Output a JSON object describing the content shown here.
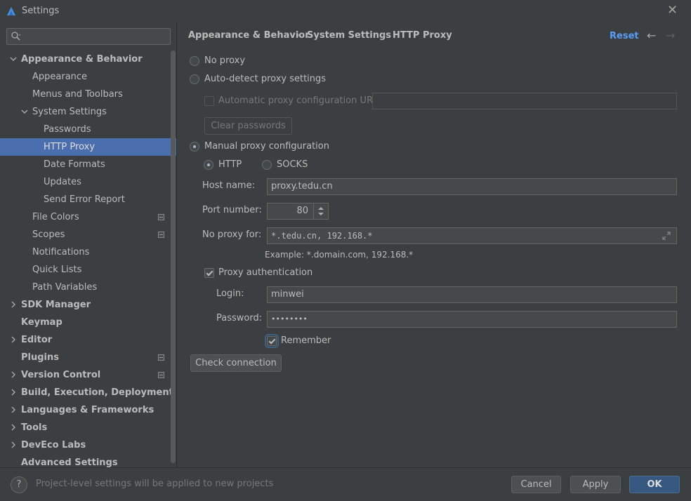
{
  "window": {
    "title": "Settings",
    "close_icon": "close-icon"
  },
  "search": {
    "placeholder": ""
  },
  "sidebar": {
    "items": [
      {
        "label": "Appearance & Behavior",
        "level": 0,
        "bold": true,
        "expanded": true
      },
      {
        "label": "Appearance",
        "level": 1
      },
      {
        "label": "Menus and Toolbars",
        "level": 1
      },
      {
        "label": "System Settings",
        "level": 1,
        "expanded": true
      },
      {
        "label": "Passwords",
        "level": 2
      },
      {
        "label": "HTTP Proxy",
        "level": 2,
        "selected": true
      },
      {
        "label": "Date Formats",
        "level": 2
      },
      {
        "label": "Updates",
        "level": 2
      },
      {
        "label": "Send Error Report",
        "level": 2
      },
      {
        "label": "File Colors",
        "level": 1,
        "badge": true
      },
      {
        "label": "Scopes",
        "level": 1,
        "badge": true
      },
      {
        "label": "Notifications",
        "level": 1
      },
      {
        "label": "Quick Lists",
        "level": 1
      },
      {
        "label": "Path Variables",
        "level": 1
      },
      {
        "label": "SDK Manager",
        "level": 0,
        "bold": true,
        "collapsed": true
      },
      {
        "label": "Keymap",
        "level": 0,
        "bold": true
      },
      {
        "label": "Editor",
        "level": 0,
        "bold": true,
        "collapsed": true
      },
      {
        "label": "Plugins",
        "level": 0,
        "bold": true,
        "badge": true
      },
      {
        "label": "Version Control",
        "level": 0,
        "bold": true,
        "collapsed": true,
        "badge": true
      },
      {
        "label": "Build, Execution, Deployment",
        "level": 0,
        "bold": true,
        "collapsed": true
      },
      {
        "label": "Languages & Frameworks",
        "level": 0,
        "bold": true,
        "collapsed": true
      },
      {
        "label": "Tools",
        "level": 0,
        "bold": true,
        "collapsed": true
      },
      {
        "label": "DevEco Labs",
        "level": 0,
        "bold": true,
        "collapsed": true
      },
      {
        "label": "Advanced Settings",
        "level": 0,
        "bold": true
      }
    ]
  },
  "breadcrumb": {
    "items": [
      "Appearance & Behavior",
      "System Settings",
      "HTTP Proxy"
    ],
    "separator": "›"
  },
  "header": {
    "reset_label": "Reset",
    "back_icon": "arrow-left-icon",
    "forward_icon": "arrow-right-icon"
  },
  "proxy": {
    "no_proxy": "No proxy",
    "auto_detect": "Auto-detect proxy settings",
    "auto_config_url_label": "Automatic proxy configuration URL:",
    "auto_config_url_value": "",
    "clear_passwords": "Clear passwords",
    "manual": "Manual proxy configuration",
    "selected_mode": "manual",
    "http_label": "HTTP",
    "socks_label": "SOCKS",
    "protocol": "HTTP",
    "host_label": "Host name:",
    "host_value": "proxy.tedu.cn",
    "port_label": "Port number:",
    "port_value": "80",
    "no_proxy_for_label": "No proxy for:",
    "no_proxy_for_value": "*.tedu.cn, 192.168.*",
    "example": "Example: *.domain.com, 192.168.*",
    "auth_label": "Proxy authentication",
    "auth_checked": true,
    "login_label": "Login:",
    "login_value": "minwei",
    "password_label": "Password:",
    "password_value": "••••••••",
    "remember_label": "Remember",
    "remember_checked": true,
    "check_connection": "Check connection"
  },
  "footer": {
    "hint": "Project-level settings will be applied to new projects",
    "help_label": "?",
    "cancel": "Cancel",
    "apply": "Apply",
    "ok": "OK"
  },
  "colors": {
    "accent": "#4b6eaf",
    "link": "#589df6",
    "background": "#3c3f41"
  }
}
